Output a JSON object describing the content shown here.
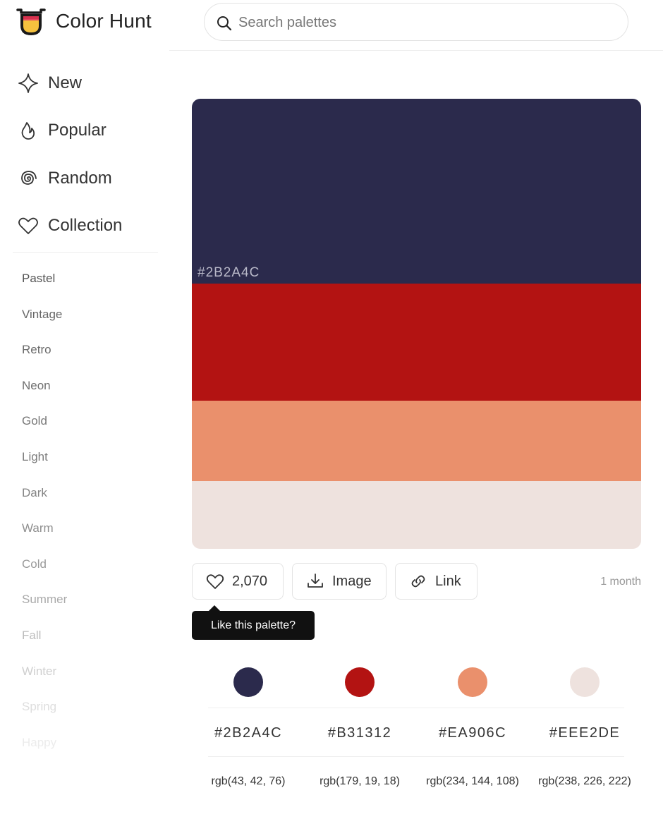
{
  "app": {
    "name": "Color Hunt"
  },
  "search": {
    "placeholder": "Search palettes",
    "value": ""
  },
  "nav": [
    {
      "label": "New",
      "icon": "sparkle-icon"
    },
    {
      "label": "Popular",
      "icon": "flame-icon"
    },
    {
      "label": "Random",
      "icon": "spiral-icon"
    },
    {
      "label": "Collection",
      "icon": "heart-icon"
    }
  ],
  "tags": [
    {
      "label": "Pastel",
      "color": "#555555"
    },
    {
      "label": "Vintage",
      "color": "#666666"
    },
    {
      "label": "Retro",
      "color": "#6b6b6b"
    },
    {
      "label": "Neon",
      "color": "#707070"
    },
    {
      "label": "Gold",
      "color": "#777777"
    },
    {
      "label": "Light",
      "color": "#7d7d7d"
    },
    {
      "label": "Dark",
      "color": "#858585"
    },
    {
      "label": "Warm",
      "color": "#8f8f8f"
    },
    {
      "label": "Cold",
      "color": "#9a9a9a"
    },
    {
      "label": "Summer",
      "color": "#aaaaaa"
    },
    {
      "label": "Fall",
      "color": "#bcbcbc"
    },
    {
      "label": "Winter",
      "color": "#cfcfcf"
    },
    {
      "label": "Spring",
      "color": "#dedede"
    },
    {
      "label": "Happy",
      "color": "#ececec"
    }
  ],
  "palette": {
    "colors": [
      {
        "hex": "#2B2A4C",
        "rgb": "rgb(43, 42, 76)",
        "css": "#2b2a4c"
      },
      {
        "hex": "#B31312",
        "rgb": "rgb(179, 19, 18)",
        "css": "#b31312"
      },
      {
        "hex": "#EA906C",
        "rgb": "rgb(234, 144, 108)",
        "css": "#ea906c"
      },
      {
        "hex": "#EEE2DE",
        "rgb": "rgb(238, 226, 222)",
        "css": "#eee2de"
      }
    ],
    "hover_label": "#2B2A4C",
    "hover_label_color": "#b8b8c8"
  },
  "actions": {
    "likes": "2,070",
    "image_label": "Image",
    "link_label": "Link",
    "age": "1 month"
  },
  "tooltip": {
    "text": "Like this palette?"
  }
}
